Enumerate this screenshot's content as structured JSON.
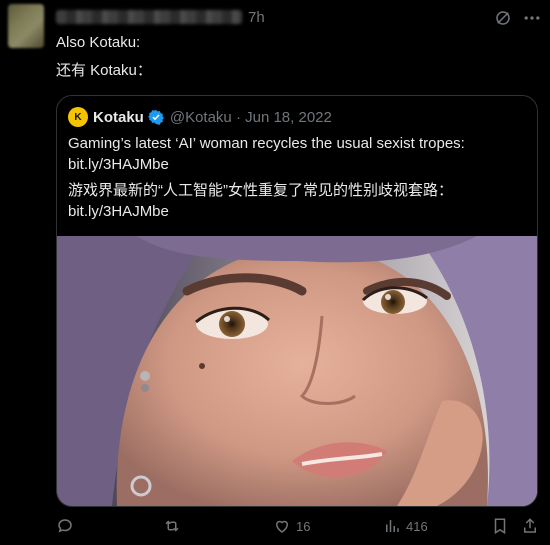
{
  "header": {
    "time": "7h"
  },
  "tweet": {
    "line1": "Also Kotaku:",
    "line2": "还有 Kotaku："
  },
  "quote": {
    "author_name": "Kotaku",
    "logo_text": "K",
    "meta": "@Kotaku · Jun 18, 2022",
    "text_en": "Gaming’s latest ‘AI’ woman recycles the usual sexist tropes:",
    "link1": "bit.ly/3HAJMbe",
    "text_zh": "游戏界最新的“人工智能”女性重复了常见的性别歧视套路：",
    "link2": "bit.ly/3HAJMbe"
  },
  "actions": {
    "reply_count": "",
    "retweet_count": "",
    "like_count": "16",
    "views_count": "416"
  },
  "colors": {
    "background": "#000000",
    "text": "#e7e9ea",
    "muted": "#71767b",
    "border": "#2f3336",
    "verified": "#1d9bf0",
    "brand": "#f5c400"
  }
}
